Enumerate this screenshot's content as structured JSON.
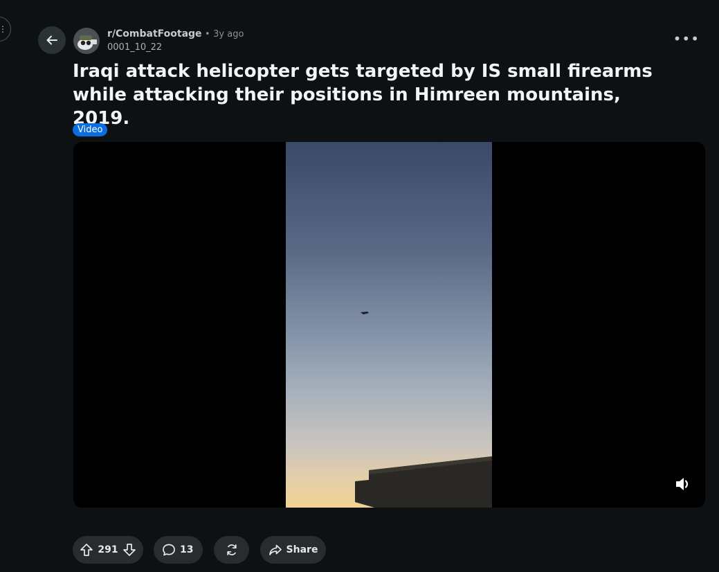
{
  "post": {
    "subreddit": "r/CombatFootage",
    "separator": "•",
    "time_ago": "3y ago",
    "author": "0001_10_22",
    "title": "Iraqi attack helicopter gets targeted by IS small firearms while attacking their positions in Himreen mountains, 2019.",
    "flair": "Video"
  },
  "actions": {
    "score": "291",
    "comments": "13",
    "share_label": "Share"
  },
  "colors": {
    "background": "#0e1113",
    "flair_bg": "#0a6ee0",
    "pill_bg": "#272c30"
  },
  "icons": [
    "back-arrow-icon",
    "more-options-icon",
    "upvote-icon",
    "downvote-icon",
    "comment-icon",
    "crosspost-icon",
    "share-icon",
    "volume-icon"
  ]
}
